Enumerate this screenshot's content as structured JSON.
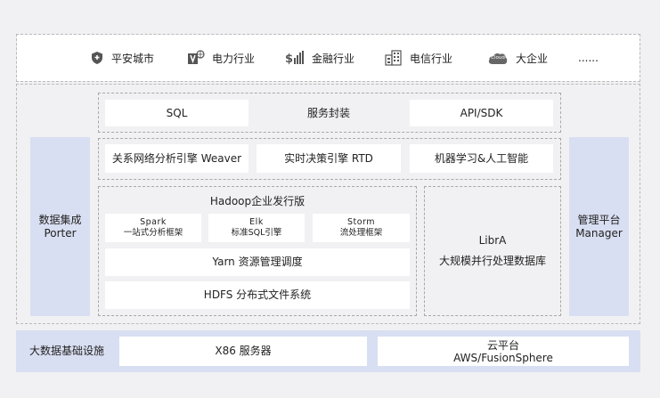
{
  "industries": [
    {
      "icon": "shield-icon",
      "label": "平安城市"
    },
    {
      "icon": "power-icon",
      "label": "电力行业"
    },
    {
      "icon": "finance-icon",
      "label": "金融行业"
    },
    {
      "icon": "building-icon",
      "label": "电信行业"
    },
    {
      "icon": "cloud-icon",
      "label": "大企业",
      "icon_text": "Cloud"
    },
    {
      "label": "......"
    }
  ],
  "left_panel": {
    "line1": "数据集成",
    "line2": "Porter"
  },
  "right_panel": {
    "line1": "管理平台",
    "line2": "Manager"
  },
  "service_row": {
    "sql": "SQL",
    "service": "服务封装",
    "api": "API/SDK"
  },
  "engine_row": {
    "weaver": "关系网络分析引擎 Weaver",
    "rtd": "实时决策引擎  RTD",
    "ml": "机器学习&人工智能"
  },
  "hadoop": {
    "title": "Hadoop企业发行版",
    "spark": {
      "name": "Spark",
      "desc": "一站式分析框架"
    },
    "elk": {
      "name": "Elk",
      "desc": "标准SQL引擎"
    },
    "storm": {
      "name": "Storm",
      "desc": "流处理框架"
    },
    "yarn": "Yarn 资源管理调度",
    "hdfs": "HDFS 分布式文件系统"
  },
  "libra": {
    "name": "LibrA",
    "desc": "大规模并行处理数据库"
  },
  "infra": {
    "label": "大数据基础设施",
    "x86": "X86 服务器",
    "cloud_line1": "云平台",
    "cloud_line2": "AWS/FusionSphere"
  },
  "colors": {
    "icon": "#555555",
    "side_panel": "#d9dff2",
    "infra_band": "#d9dff2"
  }
}
